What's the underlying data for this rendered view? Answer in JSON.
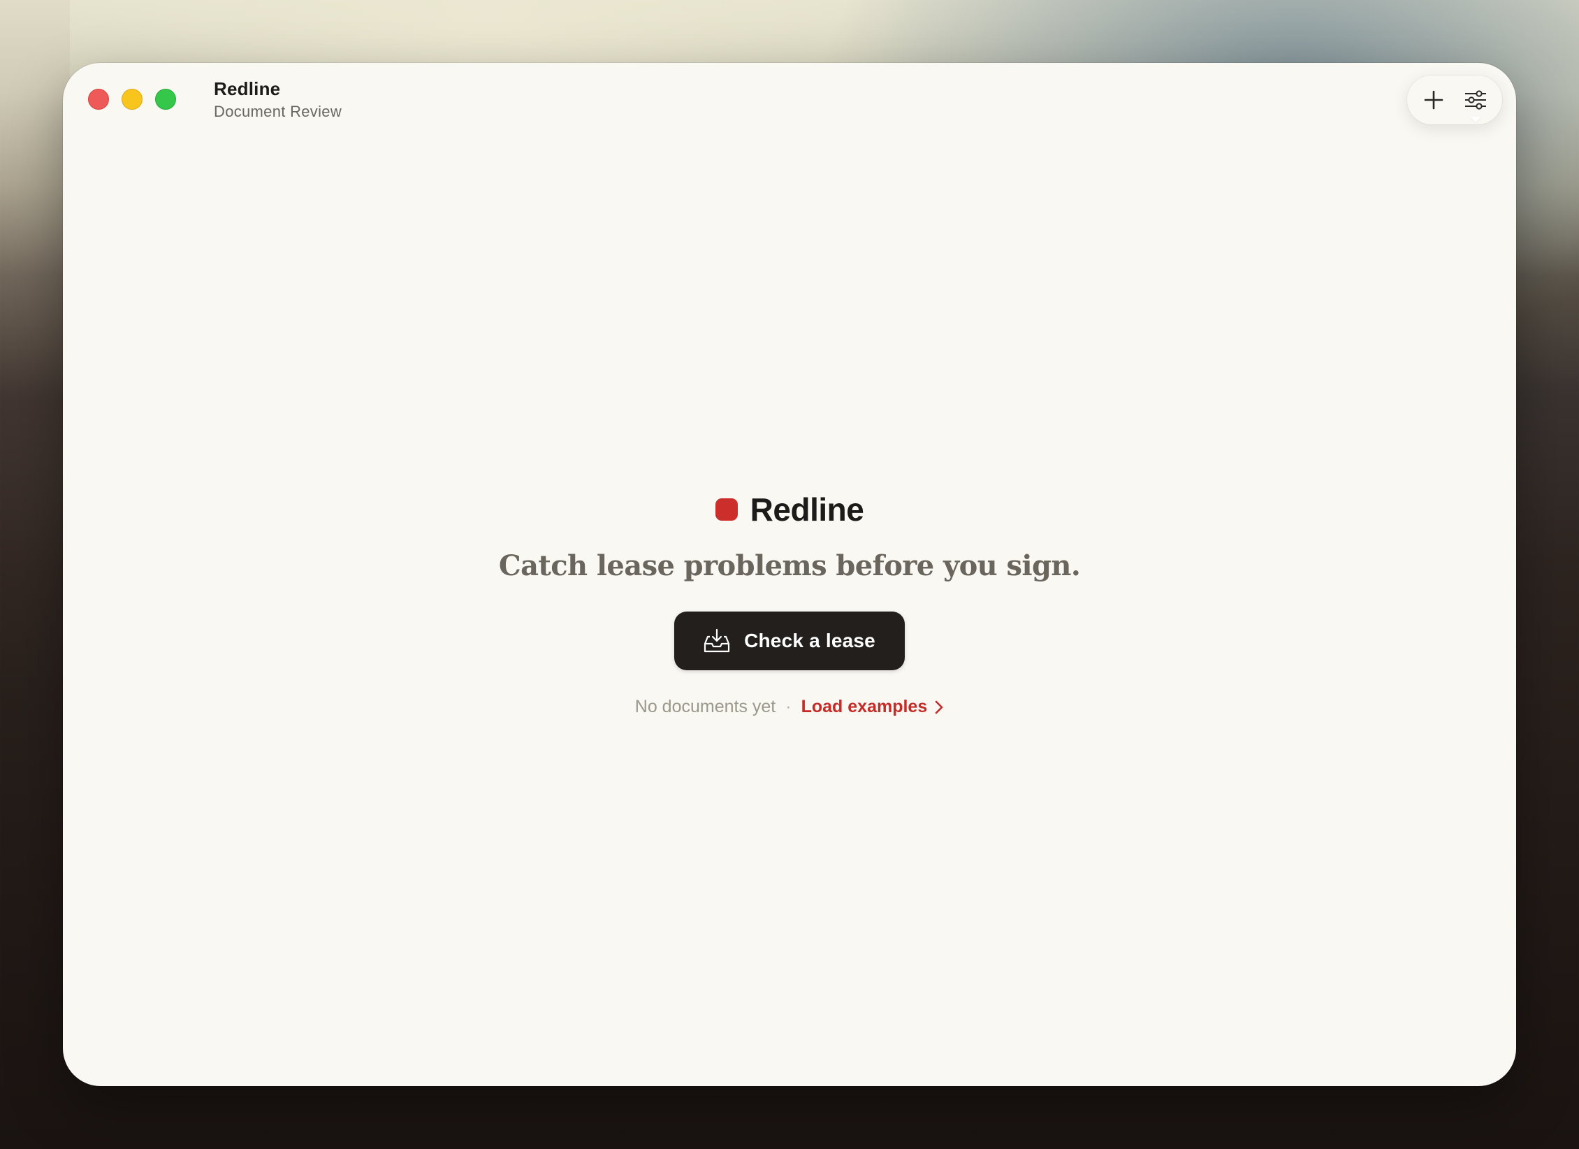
{
  "window": {
    "app_name": "Redline",
    "app_subtitle": "Document Review",
    "traffic_lights": {
      "close": "#ee5a57",
      "minimize": "#f8c51c",
      "maximize": "#35c74a"
    }
  },
  "toolbar": {
    "buttons": [
      {
        "icon": "plus-icon",
        "label": ""
      },
      {
        "icon": "sliders-icon",
        "label": ""
      }
    ]
  },
  "hero": {
    "brand_name": "Redline",
    "brand_color": "#cc2f2b",
    "tagline": "Catch lease problems before you sign.",
    "cta_label": "Check a lease",
    "cta_icon": "inbox-download-icon",
    "empty_text": "No documents yet",
    "separator": "·",
    "load_examples_label": "Load examples",
    "link_color": "#c52b27"
  }
}
